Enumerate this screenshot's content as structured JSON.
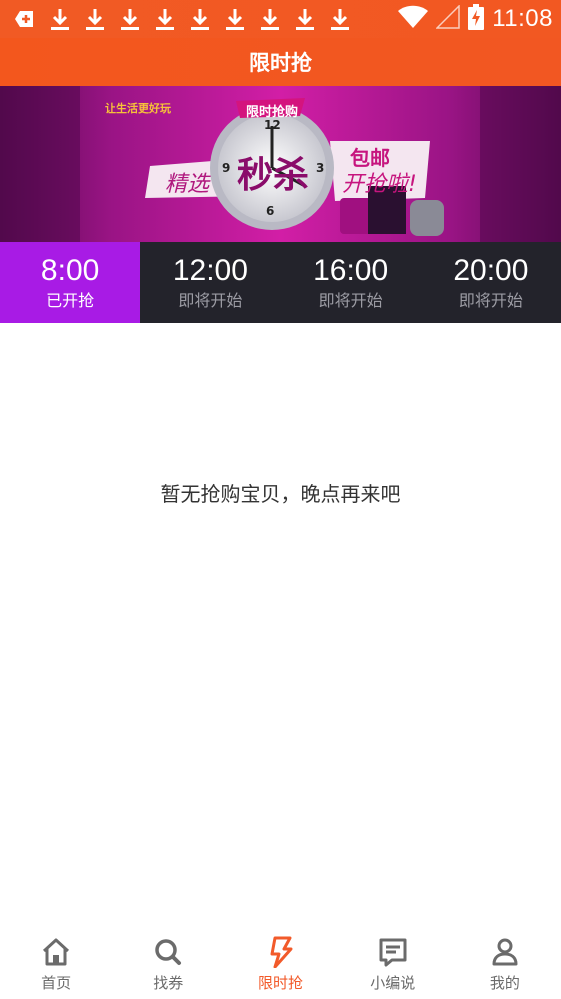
{
  "status_bar": {
    "time": "11:08",
    "icons": [
      "notification-icon",
      "download-icon",
      "download-icon",
      "download-icon",
      "download-icon",
      "download-icon",
      "download-icon",
      "download-icon",
      "download-icon",
      "download-icon",
      "wifi-icon",
      "signal-icon",
      "battery-charging-icon"
    ]
  },
  "header": {
    "title": "限时抢"
  },
  "banner": {
    "top_left_logo": "让生活更好玩",
    "badge": "限时抢购",
    "left_tag": "精选",
    "center_title": "秒杀",
    "right_tag_1": "包邮",
    "right_tag_2": "开抢啦!",
    "clock_numbers": [
      "12",
      "3",
      "6",
      "9"
    ]
  },
  "time_slots": [
    {
      "time": "8:00",
      "status": "已开抢",
      "active": true
    },
    {
      "time": "12:00",
      "status": "即将开始",
      "active": false
    },
    {
      "time": "16:00",
      "status": "即将开始",
      "active": false
    },
    {
      "time": "20:00",
      "status": "即将开始",
      "active": false
    }
  ],
  "empty_message": "暂无抢购宝贝，晚点再来吧",
  "tabs": [
    {
      "label": "首页",
      "icon": "home-icon",
      "active": false
    },
    {
      "label": "找券",
      "icon": "search-icon",
      "active": false
    },
    {
      "label": "限时抢",
      "icon": "flash-icon",
      "active": true
    },
    {
      "label": "小编说",
      "icon": "message-icon",
      "active": false
    },
    {
      "label": "我的",
      "icon": "user-icon",
      "active": false
    }
  ],
  "colors": {
    "accent": "#f25722",
    "slot_active": "#a81be5",
    "slot_bar": "#23232b",
    "tab_active": "#f25a2a",
    "banner_bg": "#c0168f"
  }
}
